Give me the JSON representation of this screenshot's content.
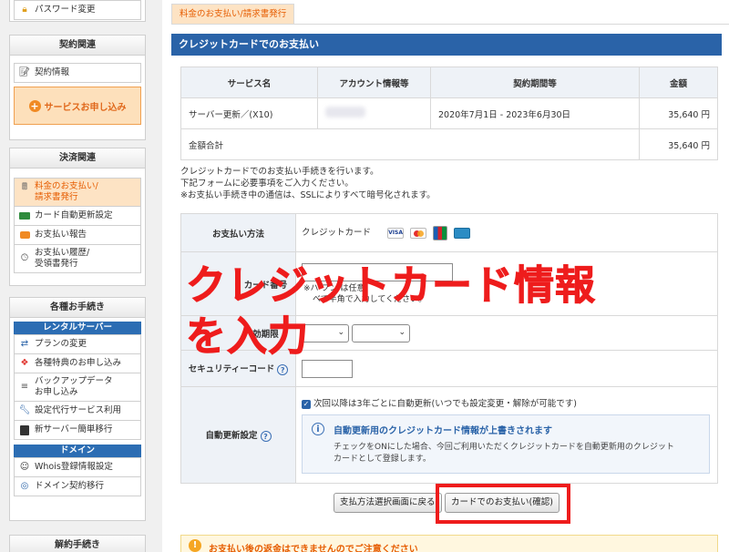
{
  "sidebar": {
    "password_item": "パスワード変更",
    "contract": {
      "heading": "契約関連",
      "info_item": "契約情報",
      "apply_button": "サービスお申し込み"
    },
    "payment": {
      "heading": "決済関連",
      "active_line1": "料金のお支払い/",
      "active_line2": "請求書発行",
      "auto_renew": "カード自動更新設定",
      "report": "お支払い報告",
      "history_line1": "お支払い履歴/",
      "history_line2": "受領書発行"
    },
    "procedures": {
      "heading": "各種お手続き",
      "rental_header": "レンタルサーバー",
      "plan_change": "プランの変更",
      "bonus": "各種特典のお申し込み",
      "backup_line1": "バックアップデータ",
      "backup_line2": "お申し込み",
      "setup_agent": "設定代行サービス利用",
      "migration": "新サーバー簡単移行",
      "domain_header": "ドメイン",
      "whois": "Whois登録情報設定",
      "domain_transfer": "ドメイン契約移行"
    },
    "cancel": {
      "heading": "解約手続き"
    }
  },
  "main": {
    "tab_label": "料金のお支払い/請求書発行",
    "section_title": "クレジットカードでのお支払い",
    "service_table": {
      "headers": [
        "サービス名",
        "アカウント情報等",
        "契約期間等",
        "金額"
      ],
      "row": {
        "service": "サーバー更新／(X10)",
        "period": "2020年7月1日 - 2023年6月30日",
        "amount": "35,640 円"
      },
      "total_label": "金額合計",
      "total_amount": "35,640 円"
    },
    "description": {
      "line1": "クレジットカードでのお支払い手続きを行います。",
      "line2": "下記フォームに必要事項をご入力ください。",
      "line3": "※お支払い手続き中の通信は、SSLによりすべて暗号化されます。"
    },
    "form": {
      "payment_method_label": "お支払い方法",
      "payment_method_value": "クレジットカード",
      "card_visa": "VISA",
      "card_number_label_visible": "カード番号",
      "card_number_note1": "※ハ     フン    は任意",
      "card_number_note2": "べて半角で入力してください。",
      "expiry_label_visible": "効期限",
      "security_code_label": "セキュリティーコード",
      "auto_renew_label": "自動更新設定",
      "auto_renew_check": "次回以降は3年ごとに自動更新(いつでも設定変更・解除が可能です)",
      "info_title": "自動更新用のクレジットカード情報が上書きされます",
      "info_text1": "チェックをONにした場合、今回ご利用いただくクレジットカードを自動更新用のクレジット",
      "info_text2": "カードとして登録します。"
    },
    "buttons": {
      "back": "支払方法選択画面に戻る",
      "confirm": "カードでのお支払い(確認)"
    },
    "overlay_text": {
      "line1": "クレジットカード情報",
      "line2": "を入力"
    },
    "notice": "お支払い後の返金はできませんのでご注意ください"
  },
  "colors": {
    "accent_blue": "#2a63a8",
    "highlight_red": "#ee1c1c",
    "active_orange": "#e65c00"
  }
}
